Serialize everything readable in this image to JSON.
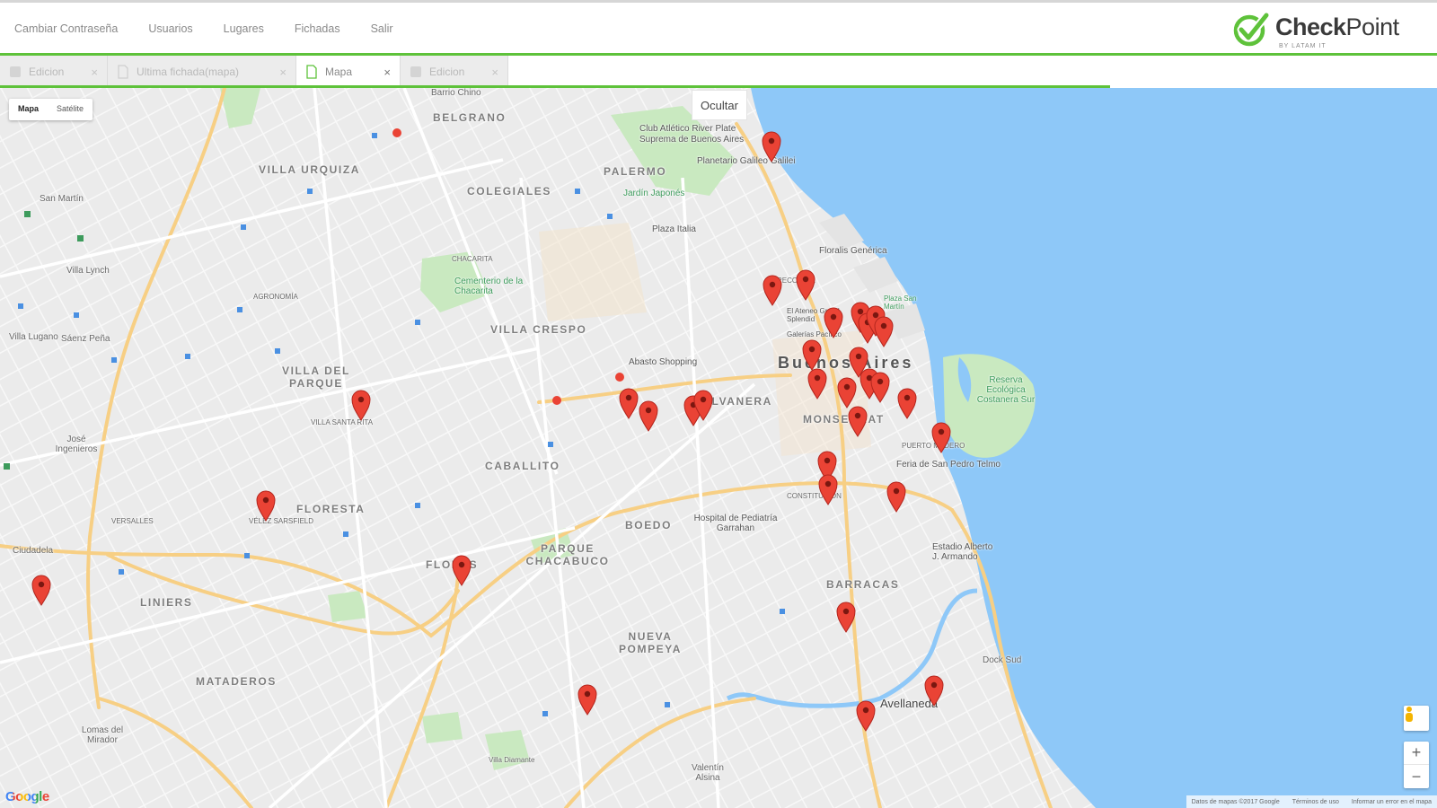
{
  "nav": {
    "items": [
      "Cambiar Contraseña",
      "Usuarios",
      "Lugares",
      "Fichadas",
      "Salir"
    ]
  },
  "brand": {
    "name_a": "Check",
    "name_b": "Point",
    "tagline": "BY LATAM IT",
    "accent_color": "#5ec23a"
  },
  "tabs": [
    {
      "label": "Edicion",
      "icon": "pencil-icon",
      "active": false
    },
    {
      "label": "Ultima fichada(mapa)",
      "icon": "document-icon",
      "active": false
    },
    {
      "label": "Mapa",
      "icon": "document-icon",
      "active": true
    },
    {
      "label": "Edicion",
      "icon": "pencil-icon",
      "active": false
    }
  ],
  "map": {
    "type_control": {
      "map": "Mapa",
      "satellite": "Satélite"
    },
    "hide_button": "Ocultar",
    "zoom_in": "+",
    "zoom_out": "−",
    "google_logo": "Google",
    "attribution": {
      "data": "Datos de mapas ©2017 Google",
      "terms": "Términos de uso",
      "report": "Informar un error en el mapa"
    },
    "labels": {
      "barrio_chino": "Barrio Chino",
      "belgrano": "BELGRANO",
      "villa_urquiza": "VILLA URQUIZA",
      "colegiales": "COLEGIALES",
      "palermo": "PALERMO",
      "san_martin": "San Martín",
      "villa_lynch": "Villa Lynch",
      "chacarita": "CHACARITA",
      "agronomia": "AGRONOMÍA",
      "villa_crespo": "VILLA CRESPO",
      "villa_del_parque": "VILLA DEL PARQUE",
      "villa_santa_rita": "VILLA SANTA RITA",
      "jose_ingenieros": "José Ingenieros",
      "caballito": "CABALLITO",
      "floresta": "FLORESTA",
      "velez": "VÉLEZ SARSFIELD",
      "versalles": "VERSALLES",
      "ciudadela": "Ciudadela",
      "liniers": "LINIERS",
      "mataderos": "MATADEROS",
      "lomas": "Lomas del Mirador",
      "villa_lugano": "Villa Lugano",
      "saenz_pena": "Sáenz Peña",
      "parque_chacabuco": "PARQUE CHACABUCO",
      "flores": "FLORES",
      "boedo": "BOEDO",
      "nueva_pompeya": "NUEVA POMPEYA",
      "balvanera": "BALVANERA",
      "monserrat": "MONSERRAT",
      "buenos_aires": "Buenos Aires",
      "puerto_madero": "PUERTO MADERO",
      "constitucion": "CONSTITUCIÓN",
      "barracas": "BARRACAS",
      "avellaneda": "Avellaneda",
      "dock_sud": "Dock Sud",
      "valentin_alsina": "Valentín Alsina",
      "villa_diamante": "Villa Diamante",
      "recoleta": "RECOLETA"
    },
    "pois": {
      "club": "Club Atlético River Plate",
      "suprema": "Suprema de Buenos Aires",
      "planetario": "Planetario Galileo Galilei",
      "jardin": "Jardín Japonés",
      "plaza_italia": "Plaza Italia",
      "floralis": "Floralis Genérica",
      "cementerio": "Cementerio de la Chacarita",
      "ateneo": "El Ateneo Grand Splendid",
      "galerias": "Galerías Pacífico",
      "abasto": "Abasto Shopping",
      "reserva": "Reserva Ecológica Costanera Sur",
      "feria": "Feria de San Pedro Telmo",
      "hospital": "Hospital de Pediatría Garrahan",
      "estadio": "Estadio Alberto J. Armando",
      "plaza_san_martin": "Plaza San Martín"
    },
    "marker_color": "#ea4335",
    "water_color": "#8ec8f8"
  }
}
